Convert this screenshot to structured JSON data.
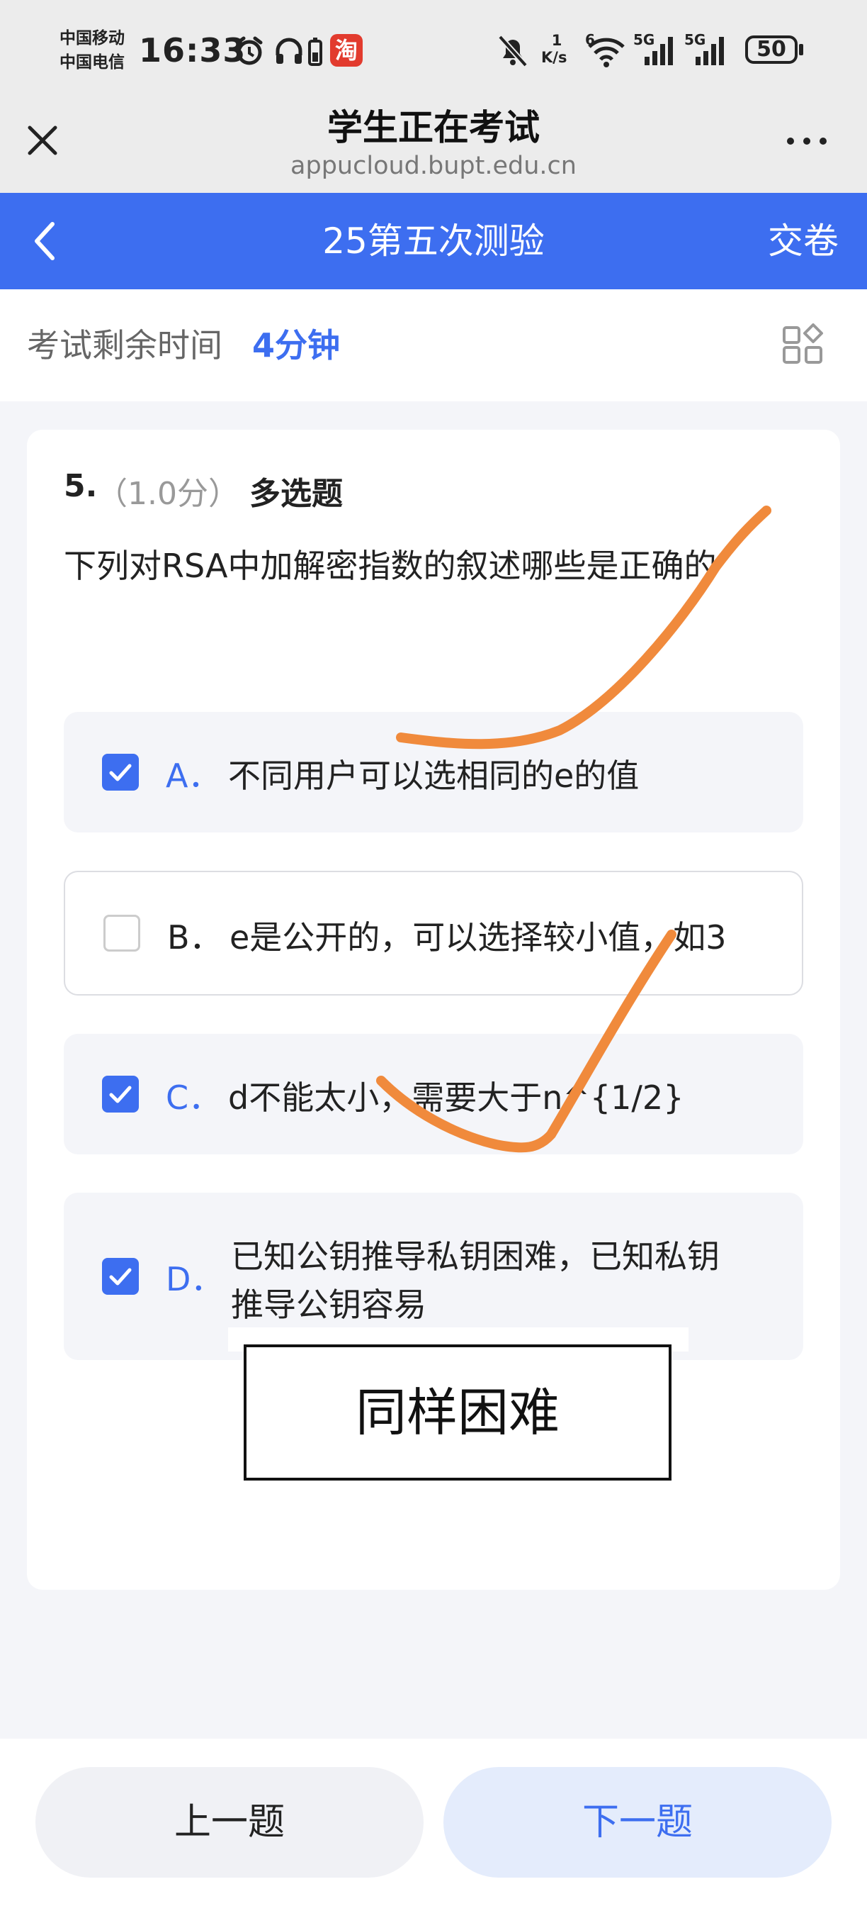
{
  "status_bar": {
    "carrier_1": "中国移动",
    "carrier_2": "中国电信",
    "time": "16:33",
    "taobao_badge": "淘",
    "net_speed_value": "1",
    "net_speed_unit": "K/s",
    "wifi_label": "6",
    "signal_1_label": "5G",
    "signal_2_label": "5G",
    "battery": "50"
  },
  "browser": {
    "title": "学生正在考试",
    "url": "appucloud.bupt.edu.cn",
    "close_icon": "close-icon",
    "more_icon": "more-icon"
  },
  "app_bar": {
    "title": "25第五次测验",
    "submit_label": "交卷",
    "back_icon": "back-chevron-icon"
  },
  "timer": {
    "label": "考试剩余时间",
    "value": "4分钟",
    "grid_icon": "question-grid-icon"
  },
  "question": {
    "number": "5.",
    "score": "（1.0分）",
    "type": "多选题",
    "text": "下列对RSA中加解密指数的叙述哪些是正确的",
    "options": [
      {
        "letter": "A．",
        "text": "不同用户可以选相同的e的值",
        "checked": true
      },
      {
        "letter": "B．",
        "text": "e是公开的，可以选择较小值，如3",
        "checked": false
      },
      {
        "letter": "C．",
        "text": "d不能太小，需要大于n^{1/2}",
        "checked": true
      },
      {
        "letter": "D．",
        "text_line1": "已知公钥推导私钥困难，已知私钥",
        "text_line2": "推导公钥容易",
        "checked": true
      }
    ]
  },
  "annotation": {
    "note": "同样困难",
    "stroke_color": "#f08a3c"
  },
  "bottom": {
    "prev_label": "上一题",
    "next_label": "下一题"
  },
  "colors": {
    "accent": "#3d6ef0",
    "background": "#f4f5f9"
  }
}
